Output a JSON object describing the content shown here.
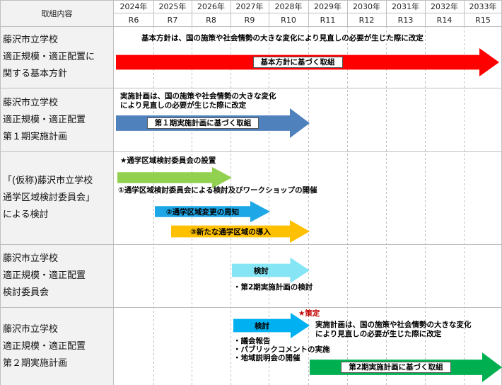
{
  "header": {
    "corner_label": "取組内容",
    "years": [
      {
        "year": "2024年",
        "era": "R6"
      },
      {
        "year": "2025年",
        "era": "R7"
      },
      {
        "year": "2026年",
        "era": "R8"
      },
      {
        "year": "2027年",
        "era": "R9"
      },
      {
        "year": "2028年",
        "era": "R10"
      },
      {
        "year": "2029年",
        "era": "R11"
      },
      {
        "year": "2030年",
        "era": "R12"
      },
      {
        "year": "2031年",
        "era": "R13"
      },
      {
        "year": "2032年",
        "era": "R14"
      },
      {
        "year": "2033年",
        "era": "R15"
      }
    ]
  },
  "rows": [
    {
      "label_lines": [
        "藤沢市立学校",
        "適正規模・適正配置に",
        "関する基本方針"
      ]
    },
    {
      "label_lines": [
        "藤沢市立学校",
        "適正規模・適正配置",
        "第１期実施計画"
      ]
    },
    {
      "label_lines": [
        "「(仮称)藤沢市立学校",
        "通学区域検討委員会」",
        "による検討"
      ]
    },
    {
      "label_lines": [
        "藤沢市立学校",
        "適正規模・適正配置",
        "検討委員会"
      ]
    },
    {
      "label_lines": [
        "藤沢市立学校",
        "適正規模・適正配置",
        "第２期実施計画"
      ]
    }
  ],
  "notes": {
    "row1_top": "基本方針は、国の施策や社会情勢の大きな変化により見直しの必要が生じた際に改定",
    "row2_top_1": "実施計画は、国の施策や社会情勢の大きな変化",
    "row2_top_2": "により見直しの必要が生じた際に改定",
    "row3_star": "★通学区域検討委員会の設置",
    "row3_item1": "①通学区域検討委員会による検討及びワークショップの開催",
    "row4_item": "・第2期実施計画の検討",
    "row5_star": "★策定",
    "row5_bul1": "・議会報告",
    "row5_bul2": "・パブリックコメントの実施",
    "row5_bul3": "・地域説明会の開催",
    "row5_right_1": "実施計画は、国の施策や社会情勢の大きな変化",
    "row5_right_2": "により見直しの必要が生じた際に改定"
  },
  "arrows": {
    "basic_policy": {
      "label": "基本方針に基づく取組",
      "color": "#ff0000",
      "start_year": "2024年",
      "end_year": "2033年"
    },
    "phase1": {
      "label": "第１期実施計画に基づく取組",
      "color": "#4f81bd",
      "start_year": "2024年",
      "end_year": "2028年"
    },
    "committee_setup": {
      "label": "",
      "color": "#92d050",
      "start_year": "2024年",
      "end_year": "2026年"
    },
    "item2": {
      "label": "②通学区域変更の周知",
      "color": "#1ea7e6",
      "start_year": "2025年",
      "end_year": "2027年"
    },
    "item3": {
      "label": "③新たな通学区域の導入",
      "color": "#ffc000",
      "start_year": "2025年",
      "end_year": "2028年"
    },
    "review4": {
      "label": "検討",
      "color": "#86e5f5",
      "start_year": "2027年",
      "end_year": "2028年"
    },
    "review5": {
      "label": "検討",
      "color": "#00b0f0",
      "start_year": "2027年",
      "end_year": "2028年"
    },
    "phase2": {
      "label": "第2期実施計画に基づく取組",
      "color": "#00b050",
      "start_year": "2029年",
      "end_year": "2033年"
    }
  },
  "colors": {
    "grid": "#bfbfbf",
    "header_bg": "#ffffff",
    "label_bg": "#ffffff",
    "dashed": "#bfbfbf"
  }
}
